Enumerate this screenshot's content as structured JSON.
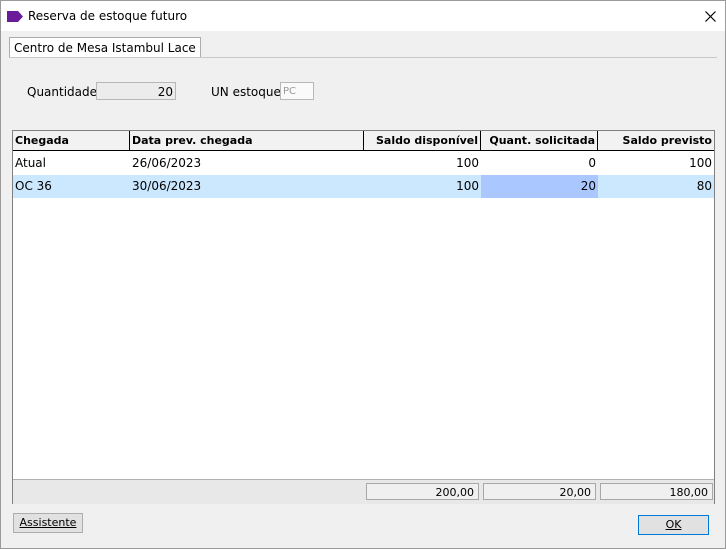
{
  "window": {
    "title": "Reserva de estoque futuro"
  },
  "tab": {
    "label": "Centro de Mesa Istambul Lace"
  },
  "form": {
    "quantidade_label": "Quantidade",
    "quantidade_value": "20",
    "un_estoque_label": "UN estoque",
    "un_estoque_value": "PC"
  },
  "table": {
    "columns": [
      "Chegada",
      "Data prev. chegada",
      "Saldo disponível",
      "Quant. solicitada",
      "Saldo previsto"
    ],
    "rows": [
      [
        "Atual",
        "26/06/2023",
        "100",
        "0",
        "100"
      ],
      [
        "OC 36",
        "30/06/2023",
        "100",
        "20",
        "80"
      ]
    ],
    "selected_row": 1,
    "totals": [
      "200,00",
      "20,00",
      "180,00"
    ]
  },
  "buttons": {
    "assistente": "Assistente",
    "ok": "OK"
  },
  "colors": {
    "title_icon": "#6a1b9a",
    "selected_row": "#cce8ff",
    "selected_cell": "#aac8ff"
  }
}
